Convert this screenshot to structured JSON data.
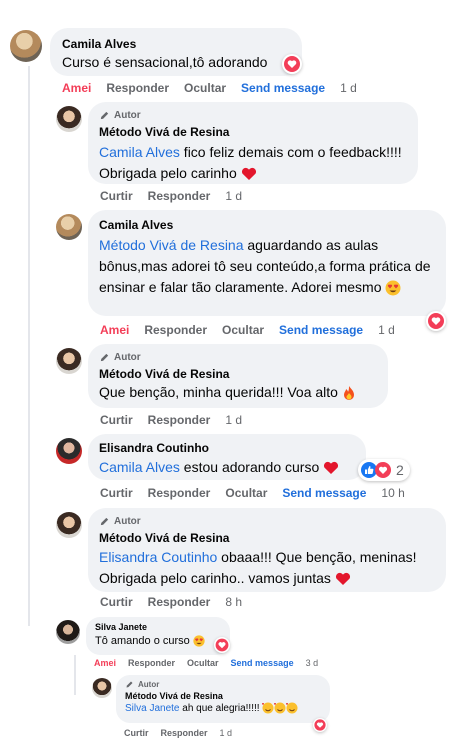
{
  "comments": [
    {
      "author": "Camila Alves",
      "text": "Curso é sensacional,tô adorando",
      "actions": {
        "like": "Amei",
        "reply": "Responder",
        "hide": "Ocultar",
        "send": "Send message",
        "time": "1 d"
      }
    },
    {
      "badge": "Autor",
      "author": "Método Vivá de Resina",
      "mention": "Camila Alves",
      "text": " fico feliz demais com o feedback!!!! Obrigada pelo carinho",
      "actions": {
        "like": "Curtir",
        "reply": "Responder",
        "time": "1 d"
      }
    },
    {
      "author": "Camila Alves",
      "mention": "Método Vivá de Resina",
      "text": " aguardando as aulas bônus,mas adorei tô seu conteúdo,a forma prática de ensinar e falar tão claramente. Adorei mesmo",
      "actions": {
        "like": "Amei",
        "reply": "Responder",
        "hide": "Ocultar",
        "send": "Send message",
        "time": "1 d"
      }
    },
    {
      "badge": "Autor",
      "author": "Método Vivá de Resina",
      "text": "Que benção, minha querida!!! Voa alto",
      "actions": {
        "like": "Curtir",
        "reply": "Responder",
        "time": "1 d"
      }
    },
    {
      "author": "Elisandra Coutinho",
      "mention": "Camila Alves",
      "text": " estou adorando curso",
      "reaction_count": "2",
      "actions": {
        "like": "Curtir",
        "reply": "Responder",
        "hide": "Ocultar",
        "send": "Send message",
        "time": "10 h"
      }
    },
    {
      "badge": "Autor",
      "author": "Método Vivá de Resina",
      "mention": "Elisandra Coutinho",
      "text": " obaaa!!! Que benção, meninas! Obrigada pelo carinho.. vamos juntas",
      "actions": {
        "like": "Curtir",
        "reply": "Responder",
        "time": "8 h"
      }
    },
    {
      "author": "Silva Janete",
      "text": "Tô amando o curso",
      "actions": {
        "like": "Amei",
        "reply": "Responder",
        "hide": "Ocultar",
        "send": "Send message",
        "time": "3 d"
      }
    },
    {
      "badge": "Autor",
      "author": "Método Vivá de Resina",
      "mention": "Silva Janete",
      "text": " ah que alegria!!!!!",
      "actions": {
        "like": "Curtir",
        "reply": "Responder",
        "time": "1 d"
      }
    }
  ],
  "icons": {
    "heart_reaction": "heart-icon",
    "like_reaction": "like-icon",
    "pencil": "pencil-icon",
    "fire": "fire-emoji",
    "heart_eyes": "heart-eyes-emoji",
    "hearts_face": "smiling-face-with-hearts-emoji"
  },
  "colors": {
    "love": "#f33e58",
    "link": "#216fdb",
    "bubble": "#f0f2f5",
    "muted": "#65676b"
  }
}
